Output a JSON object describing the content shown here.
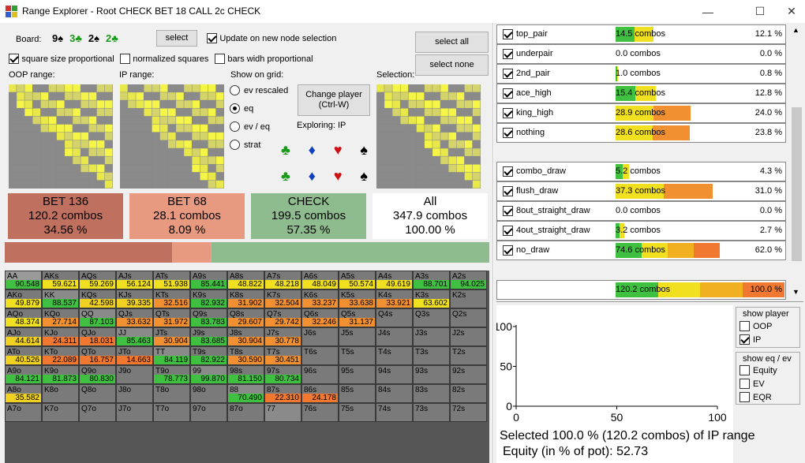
{
  "window": {
    "title": "Range Explorer  - Root CHECK BET 18 CALL 2c CHECK"
  },
  "board": {
    "label": "Board:",
    "cards": [
      {
        "rank": "9",
        "suit": "♠",
        "color": "#000000"
      },
      {
        "rank": "3",
        "suit": "♣",
        "color": "#1a9a1a"
      },
      {
        "rank": "2",
        "suit": "♠",
        "color": "#000000"
      },
      {
        "rank": "2",
        "suit": "♣",
        "color": "#1a9a1a"
      }
    ],
    "select_label": "select",
    "update_label": "Update on new node selection"
  },
  "options": {
    "square_size": "square size proportional",
    "normalized": "normalized squares",
    "bars_width": "bars widh proportional"
  },
  "select_all": "select all",
  "select_none": "select none",
  "oop_range_label": "OOP range:",
  "ip_range_label": "IP range:",
  "selection_label": "Selection:",
  "show_grid": {
    "label": "Show on grid:",
    "options": [
      "ev rescaled",
      "eq",
      "ev / eq",
      "strat"
    ],
    "selected": "eq"
  },
  "change_player": {
    "line1": "Change player",
    "line2": "(Ctrl-W)"
  },
  "exploring": "Exploring: IP",
  "actions": [
    {
      "name": "BET 136",
      "combos": "120.2 combos",
      "pct": "34.56 %",
      "color": "#c0705e",
      "share": 34.56
    },
    {
      "name": "BET 68",
      "combos": "28.1 combos",
      "pct": "8.09 %",
      "color": "#e89a80",
      "share": 8.09
    },
    {
      "name": "CHECK",
      "combos": "199.5 combos",
      "pct": "57.35 %",
      "color": "#8fbc8f",
      "share": 57.35
    },
    {
      "name": "All",
      "combos": "347.9 combos",
      "pct": "100.00 %",
      "color": "#ffffff"
    }
  ],
  "matrix": [
    [
      [
        "AA",
        "90.548"
      ],
      [
        "AKs",
        "59.621"
      ],
      [
        "AQs",
        "59.269"
      ],
      [
        "AJs",
        "56.124"
      ],
      [
        "ATs",
        "51.938"
      ],
      [
        "A9s",
        "85.441"
      ],
      [
        "A8s",
        "48.822"
      ],
      [
        "A7s",
        "48.218"
      ],
      [
        "A6s",
        "48.049"
      ],
      [
        "A5s",
        "50.574"
      ],
      [
        "A4s",
        "49.619"
      ],
      [
        "A3s",
        "88.701"
      ],
      [
        "A2s",
        "94.025"
      ]
    ],
    [
      [
        "AKo",
        "49.879"
      ],
      [
        "KK",
        "88.537"
      ],
      [
        "KQs",
        "42.598"
      ],
      [
        "KJs",
        "39.335"
      ],
      [
        "KTs",
        "32.516"
      ],
      [
        "K9s",
        "82.932"
      ],
      [
        "K8s",
        "31.902"
      ],
      [
        "K7s",
        "32.504"
      ],
      [
        "K6s",
        "33.237"
      ],
      [
        "K5s",
        "33.638"
      ],
      [
        "K4s",
        "33.921"
      ],
      [
        "K3s",
        "63.602"
      ],
      [
        "K2s",
        ""
      ]
    ],
    [
      [
        "AQo",
        "48.374"
      ],
      [
        "KQo",
        "27.714"
      ],
      [
        "QQ",
        "87.103"
      ],
      [
        "QJs",
        "33.632"
      ],
      [
        "QTs",
        "31.972"
      ],
      [
        "Q9s",
        "83.783"
      ],
      [
        "Q8s",
        "29.607"
      ],
      [
        "Q7s",
        "29.742"
      ],
      [
        "Q6s",
        "32.246"
      ],
      [
        "Q5s",
        "31.137"
      ],
      [
        "Q4s",
        ""
      ],
      [
        "Q3s",
        ""
      ],
      [
        "Q2s",
        ""
      ]
    ],
    [
      [
        "AJo",
        "44.614"
      ],
      [
        "KJo",
        "24.311"
      ],
      [
        "QJo",
        "18.031"
      ],
      [
        "JJ",
        "85.463"
      ],
      [
        "JTs",
        "30.904"
      ],
      [
        "J9s",
        "83.685"
      ],
      [
        "J8s",
        "30.904"
      ],
      [
        "J7s",
        "30.778"
      ],
      [
        "J6s",
        ""
      ],
      [
        "J5s",
        ""
      ],
      [
        "J4s",
        ""
      ],
      [
        "J3s",
        ""
      ],
      [
        "J2s",
        ""
      ]
    ],
    [
      [
        "ATo",
        "40.526"
      ],
      [
        "KTo",
        "22.089"
      ],
      [
        "QTo",
        "16.757"
      ],
      [
        "JTo",
        "14.663"
      ],
      [
        "TT",
        "84.119"
      ],
      [
        "T9s",
        "82.922"
      ],
      [
        "T8s",
        "30.590"
      ],
      [
        "T7s",
        "30.451"
      ],
      [
        "T6s",
        ""
      ],
      [
        "T5s",
        ""
      ],
      [
        "T4s",
        ""
      ],
      [
        "T3s",
        ""
      ],
      [
        "T2s",
        ""
      ]
    ],
    [
      [
        "A9o",
        "84.121"
      ],
      [
        "K9o",
        "81.873"
      ],
      [
        "Q9o",
        "80.830"
      ],
      [
        "J9o",
        ""
      ],
      [
        "T9o",
        "78.773"
      ],
      [
        "99",
        "99.870"
      ],
      [
        "98s",
        "81.150"
      ],
      [
        "97s",
        "80.734"
      ],
      [
        "96s",
        ""
      ],
      [
        "95s",
        ""
      ],
      [
        "94s",
        ""
      ],
      [
        "93s",
        ""
      ],
      [
        "92s",
        ""
      ]
    ],
    [
      [
        "A8o",
        "35.582"
      ],
      [
        "K8o",
        ""
      ],
      [
        "Q8o",
        ""
      ],
      [
        "J8o",
        ""
      ],
      [
        "T8o",
        ""
      ],
      [
        "98o",
        ""
      ],
      [
        "88",
        "70.490"
      ],
      [
        "87s",
        "22.310"
      ],
      [
        "86s",
        "24.178"
      ],
      [
        "85s",
        ""
      ],
      [
        "84s",
        ""
      ],
      [
        "83s",
        ""
      ],
      [
        "82s",
        ""
      ]
    ],
    [
      [
        "A7o",
        ""
      ],
      [
        "K7o",
        ""
      ],
      [
        "Q7o",
        ""
      ],
      [
        "J7o",
        ""
      ],
      [
        "T7o",
        ""
      ],
      [
        "97o",
        ""
      ],
      [
        "87o",
        ""
      ],
      [
        "77",
        ""
      ],
      [
        "76s",
        ""
      ],
      [
        "75s",
        ""
      ],
      [
        "74s",
        ""
      ],
      [
        "73s",
        ""
      ],
      [
        "72s",
        ""
      ]
    ]
  ],
  "stats_hands": [
    {
      "name": "top_pair",
      "combos": "14.5 combos",
      "pct": "12.1 %",
      "frac": 0.121
    },
    {
      "name": "underpair",
      "combos": "0.0 combos",
      "pct": "0.0 %",
      "frac": 0.0
    },
    {
      "name": "2nd_pair",
      "combos": "1.0 combos",
      "pct": "0.8 %",
      "frac": 0.008
    },
    {
      "name": "ace_high",
      "combos": "15.4 combos",
      "pct": "12.8 %",
      "frac": 0.128
    },
    {
      "name": "king_high",
      "combos": "28.9 combos",
      "pct": "24.0 %",
      "frac": 0.24
    },
    {
      "name": "nothing",
      "combos": "28.6 combos",
      "pct": "23.8 %",
      "frac": 0.238
    }
  ],
  "stats_draws": [
    {
      "name": "combo_draw",
      "combos": "5.2 combos",
      "pct": "4.3 %",
      "frac": 0.043
    },
    {
      "name": "flush_draw",
      "combos": "37.3 combos",
      "pct": "31.0 %",
      "frac": 0.31
    },
    {
      "name": "8out_straight_draw",
      "combos": "0.0 combos",
      "pct": "0.0 %",
      "frac": 0.0
    },
    {
      "name": "4out_straight_draw",
      "combos": "3.2 combos",
      "pct": "2.7 %",
      "frac": 0.027
    },
    {
      "name": "no_draw",
      "combos": "74.6 combos",
      "pct": "62.0 %",
      "frac": 0.62
    }
  ],
  "stats_total": {
    "combos": "120.2 combos",
    "pct": "100.0 %",
    "frac": 1.0
  },
  "chart": {
    "y_ticks": [
      "100",
      "50",
      "0"
    ],
    "x_ticks": [
      "0",
      "50",
      "100"
    ]
  },
  "show_player": {
    "label": "show player",
    "options": [
      {
        "name": "OOP",
        "on": false
      },
      {
        "name": "IP",
        "on": true
      }
    ]
  },
  "show_eq": {
    "label": "show eq / ev",
    "options": [
      {
        "name": "Equity",
        "on": false
      },
      {
        "name": "EV",
        "on": false
      },
      {
        "name": "EQR",
        "on": false
      }
    ]
  },
  "summary": {
    "line1": "Selected 100.0 % (120.2 combos) of IP range",
    "line2": "Equity (in % of pot): 52.73"
  }
}
